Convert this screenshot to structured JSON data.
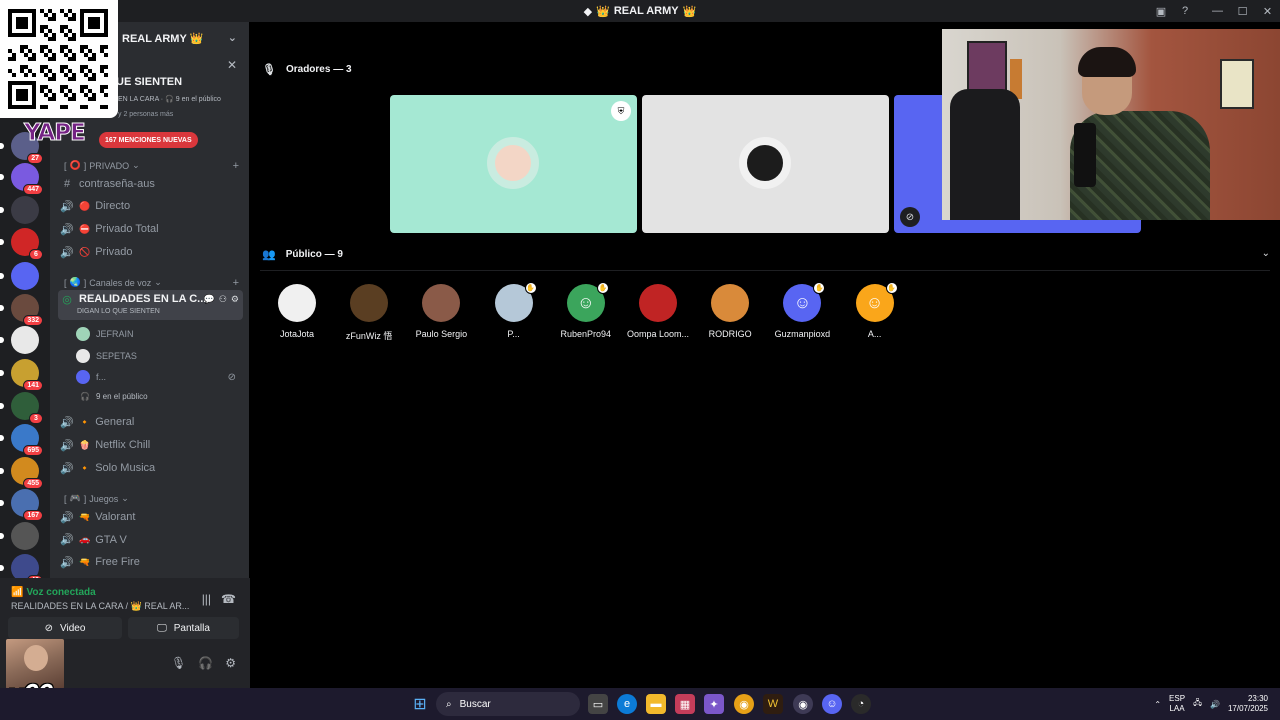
{
  "window": {
    "title": "REAL ARMY",
    "title_emoji": "👑"
  },
  "server": {
    "name": "REAL ARMY 👑",
    "event": {
      "title": "UE SIENTEN",
      "subtitle": "EN LA CARA",
      "audience": "9 en el público",
      "people": "y 2 personas más"
    },
    "mentions_pill": "167 MENCIONES NUEVAS"
  },
  "server_rail": [
    {
      "name": "server-1",
      "badge": "27",
      "color": "#5b5f8a"
    },
    {
      "name": "server-2",
      "badge": "447",
      "color": "#7a5ae0"
    },
    {
      "name": "server-3",
      "badge": "",
      "color": "#3b3b45"
    },
    {
      "name": "server-4",
      "badge": "6",
      "color": "#d02626"
    },
    {
      "name": "server-5",
      "badge": "",
      "color": "#5865f2"
    },
    {
      "name": "server-6",
      "badge": "332",
      "color": "#6a4a3e"
    },
    {
      "name": "server-7",
      "badge": "",
      "color": "#e8e8e8"
    },
    {
      "name": "server-8",
      "badge": "141",
      "color": "#c8a030"
    },
    {
      "name": "server-9",
      "badge": "3",
      "color": "#2f5e3a"
    },
    {
      "name": "server-10",
      "badge": "695",
      "color": "#3a79c9"
    },
    {
      "name": "server-11",
      "badge": "455",
      "color": "#d28a1e"
    },
    {
      "name": "server-12",
      "badge": "167",
      "color": "#4a6fb0"
    },
    {
      "name": "server-13",
      "badge": "",
      "color": "#555"
    },
    {
      "name": "server-14",
      "badge": "40",
      "color": "#3e4a8c"
    }
  ],
  "categories": {
    "privado": "PRIVADO",
    "voz": "Canales de voz",
    "juegos": "Juegos"
  },
  "text_channels": [
    {
      "name": "contraseña-aus"
    }
  ],
  "private_channels": [
    {
      "emoji": "🔴",
      "name": "Directo"
    },
    {
      "emoji": "⛔",
      "name": "Privado Total"
    },
    {
      "emoji": "🚫",
      "name": "Privado"
    }
  ],
  "active_channel": {
    "name": "REALIDADES EN LA C...",
    "topic": "DIGAN LO QUE SIENTEN",
    "members": [
      "JEFRAIN",
      "SEPETAS",
      "f..."
    ],
    "audience": "9 en el público"
  },
  "voice_channels": [
    {
      "emoji": "🔸",
      "name": "General"
    },
    {
      "emoji": "🍿",
      "name": "Netflix Chill"
    },
    {
      "emoji": "🔸",
      "name": "Solo Musica"
    }
  ],
  "game_channels": [
    {
      "emoji": "🔫",
      "name": "Valorant"
    },
    {
      "emoji": "🚗",
      "name": "GTA V"
    },
    {
      "emoji": "🔫",
      "name": "Free Fire"
    }
  ],
  "voice_panel": {
    "status": "Voz conectada",
    "location": "REALIDADES EN LA CARA / 👑 REAL AR...",
    "video_label": "Video",
    "screen_label": "Pantalla",
    "overlay_text": "x66",
    "weather": "espejado"
  },
  "stage": {
    "speakers_header": "Oradores — 3",
    "audience_header": "Público — 9",
    "speakers": [
      {
        "color": "#a5e8d3"
      },
      {
        "color": "#e3e3e3"
      },
      {
        "color": "#5865f2"
      }
    ],
    "audience": [
      {
        "name": "JotaJota",
        "color": "#f0f0f0",
        "icon": "",
        "hand": false
      },
      {
        "name": "zFunWiz 悟",
        "color": "#5a3e22",
        "icon": "",
        "hand": false
      },
      {
        "name": "Paulo Sergio",
        "color": "#8a5a48",
        "icon": "",
        "hand": false
      },
      {
        "name": "P...",
        "color": "#b5c8d8",
        "icon": "",
        "hand": true
      },
      {
        "name": "RubenPro94",
        "color": "#3ba55c",
        "icon": "discord",
        "hand": true
      },
      {
        "name": "Oompa Loom...",
        "color": "#c02424",
        "icon": "",
        "hand": false
      },
      {
        "name": "RODRIGO",
        "color": "#d98a3a",
        "icon": "",
        "hand": false
      },
      {
        "name": "Guzmanpioxd",
        "color": "#5865f2",
        "icon": "discord",
        "hand": true
      },
      {
        "name": "A...",
        "color": "#faa61a",
        "icon": "discord",
        "hand": true
      }
    ]
  },
  "taskbar": {
    "search_placeholder": "Buscar",
    "lang_top": "ESP",
    "lang_bottom": "LAA",
    "time": "23:30",
    "date": "17/07/2025"
  }
}
